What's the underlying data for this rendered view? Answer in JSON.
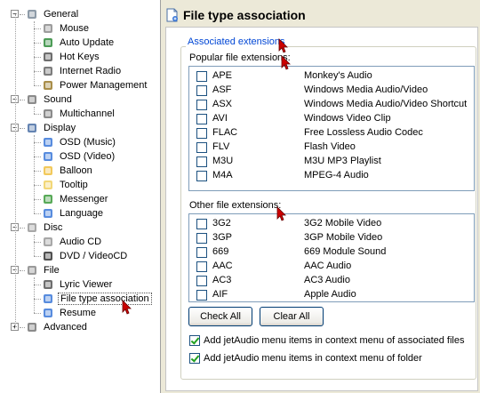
{
  "tree": {
    "items": [
      {
        "label": "General",
        "icon": "settings-page-icon",
        "level": 0,
        "expander": "minus"
      },
      {
        "label": "Mouse",
        "icon": "mouse-icon",
        "level": 1
      },
      {
        "label": "Auto Update",
        "icon": "globe-update-icon",
        "level": 1
      },
      {
        "label": "Hot Keys",
        "icon": "keyboard-icon",
        "level": 1
      },
      {
        "label": "Internet Radio",
        "icon": "radio-icon",
        "level": 1
      },
      {
        "label": "Power Management",
        "icon": "power-icon",
        "level": 1
      },
      {
        "label": "Sound",
        "icon": "speaker-icon",
        "level": 0,
        "expander": "minus"
      },
      {
        "label": "Multichannel",
        "icon": "multichannel-speaker-icon",
        "level": 1
      },
      {
        "label": "Display",
        "icon": "monitor-icon",
        "level": 0,
        "expander": "minus"
      },
      {
        "label": "OSD (Music)",
        "icon": "osd-icon",
        "level": 1
      },
      {
        "label": "OSD (Video)",
        "icon": "osd-icon",
        "level": 1
      },
      {
        "label": "Balloon",
        "icon": "balloon-icon",
        "level": 1
      },
      {
        "label": "Tooltip",
        "icon": "tooltip-icon",
        "level": 1
      },
      {
        "label": "Messenger",
        "icon": "messenger-icon",
        "level": 1
      },
      {
        "label": "Language",
        "icon": "language-icon",
        "level": 1
      },
      {
        "label": "Disc",
        "icon": "disc-icon",
        "level": 0,
        "expander": "minus"
      },
      {
        "label": "Audio CD",
        "icon": "cd-icon",
        "level": 1
      },
      {
        "label": "DVD / VideoCD",
        "icon": "dvd-icon",
        "level": 1
      },
      {
        "label": "File",
        "icon": "file-icon",
        "level": 0,
        "expander": "minus"
      },
      {
        "label": "Lyric Viewer",
        "icon": "microphone-icon",
        "level": 1
      },
      {
        "label": "File type association",
        "icon": "file-association-icon",
        "level": 1,
        "selected": true
      },
      {
        "label": "Resume",
        "icon": "resume-icon",
        "level": 1
      },
      {
        "label": "Advanced",
        "icon": "advanced-icon",
        "level": 0,
        "expander": "plus"
      }
    ]
  },
  "header": {
    "title": "File type association",
    "icon": "file-association-icon"
  },
  "group": {
    "legend": "Associated extensions"
  },
  "popular": {
    "label": "Popular file extensions:",
    "rows": [
      {
        "ext": "APE",
        "desc": "Monkey's Audio",
        "checked": false
      },
      {
        "ext": "ASF",
        "desc": "Windows Media Audio/Video",
        "checked": false
      },
      {
        "ext": "ASX",
        "desc": "Windows Media Audio/Video Shortcut",
        "checked": false
      },
      {
        "ext": "AVI",
        "desc": "Windows Video Clip",
        "checked": false
      },
      {
        "ext": "FLAC",
        "desc": "Free Lossless Audio Codec",
        "checked": false
      },
      {
        "ext": "FLV",
        "desc": "Flash Video",
        "checked": false
      },
      {
        "ext": "M3U",
        "desc": "M3U MP3 Playlist",
        "checked": false
      },
      {
        "ext": "M4A",
        "desc": "MPEG-4 Audio",
        "checked": false
      }
    ]
  },
  "other": {
    "label": "Other file extensions:",
    "rows": [
      {
        "ext": "3G2",
        "desc": "3G2 Mobile Video",
        "checked": false
      },
      {
        "ext": "3GP",
        "desc": "3GP Mobile Video",
        "checked": false
      },
      {
        "ext": "669",
        "desc": "669 Module Sound",
        "checked": false
      },
      {
        "ext": "AAC",
        "desc": "AAC Audio",
        "checked": false
      },
      {
        "ext": "AC3",
        "desc": "AC3 Audio",
        "checked": false
      },
      {
        "ext": "AIF",
        "desc": "Apple Audio",
        "checked": false
      }
    ]
  },
  "buttons": {
    "check_all": "Check All",
    "clear_all": "Clear All"
  },
  "options": {
    "context_assoc": {
      "label": "Add jetAudio menu items in context menu of associated files",
      "checked": true
    },
    "context_folder": {
      "label": "Add jetAudio menu items in context menu of folder",
      "checked": true
    }
  },
  "colors": {
    "accent_legend": "#0046d5",
    "cursor": "#cc0000"
  }
}
